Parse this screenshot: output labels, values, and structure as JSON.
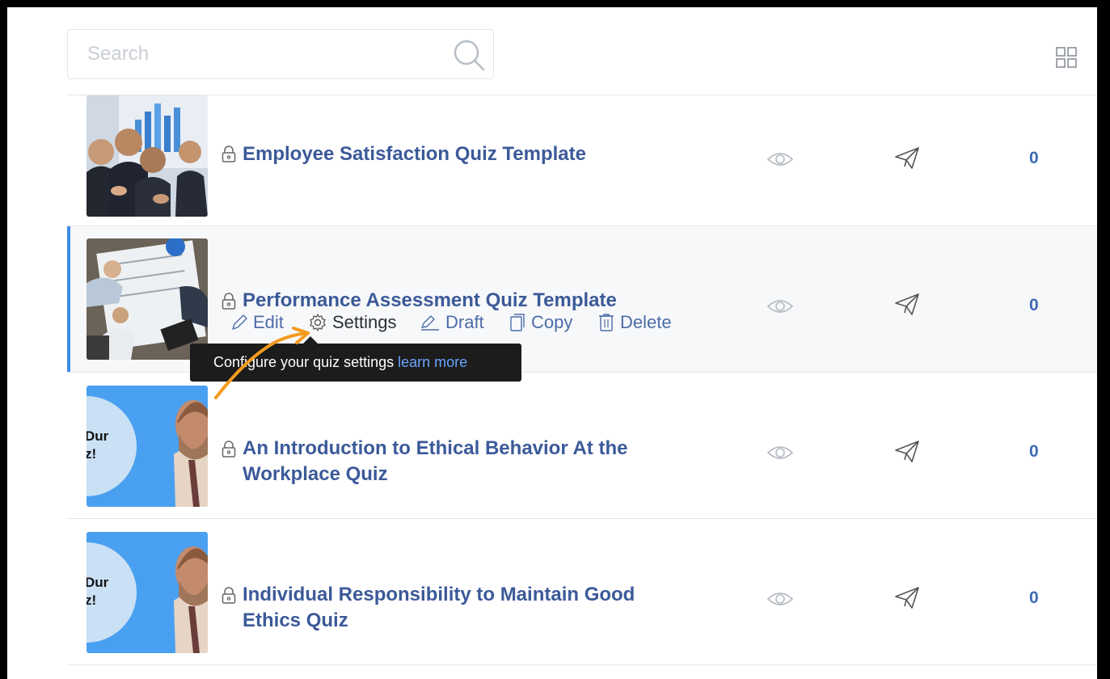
{
  "search": {
    "placeholder": "Search",
    "value": ""
  },
  "quizzes": [
    {
      "title": "Employee Satisfaction Quiz Template",
      "count": "0"
    },
    {
      "title": "Performance Assessment Quiz Template",
      "count": "0"
    },
    {
      "title": "An Introduction to Ethical Behavior At the Workplace Quiz",
      "count": "0",
      "thumb_text": "Dur\nz!"
    },
    {
      "title": "Individual Responsibility to Maintain Good Ethics Quiz",
      "count": "0",
      "thumb_text": "Dur\nz!"
    }
  ],
  "actions": {
    "edit": "Edit",
    "settings": "Settings",
    "draft": "Draft",
    "copy": "Copy",
    "delete": "Delete"
  },
  "tooltip": {
    "text": "Configure your quiz settings",
    "link": "learn more"
  },
  "icons": [
    "search-icon",
    "grid-view-icon",
    "lock-icon",
    "eye-icon",
    "send-icon",
    "pencil-icon",
    "gear-icon",
    "draft-icon",
    "copy-icon",
    "trash-icon"
  ],
  "colors": {
    "title": "#3c5a99",
    "count": "#3d6bb3",
    "active_border": "#3d8be6",
    "tooltip_bg": "#1c1c1c",
    "tooltip_link": "#6aa5ff",
    "arrow": "#f39a1e"
  }
}
